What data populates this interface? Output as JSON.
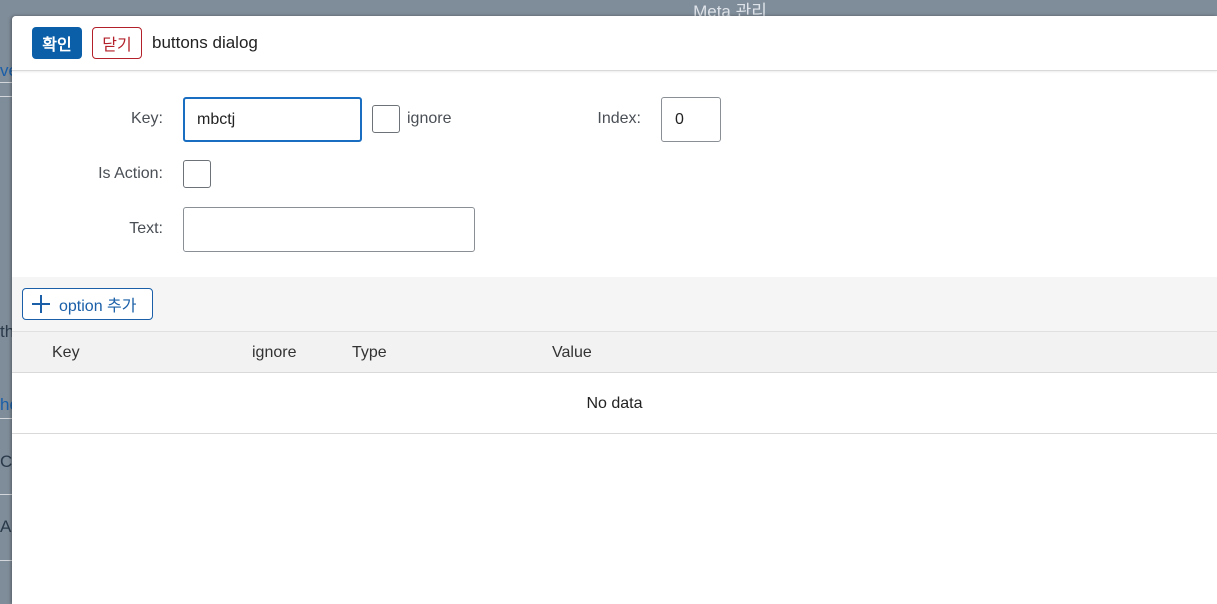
{
  "background": {
    "title": "Meta 관리",
    "left_fragments": [
      "ve",
      "th",
      "he",
      "Co",
      "Ad"
    ]
  },
  "dialog": {
    "confirm_label": "확인",
    "close_label": "닫기",
    "title": "buttons dialog"
  },
  "form": {
    "key_label": "Key:",
    "key_value": "mbctj",
    "ignore_label": "ignore",
    "index_label": "Index:",
    "index_value": "0",
    "is_action_label": "Is Action:",
    "text_label": "Text:",
    "text_value": ""
  },
  "toolbar": {
    "add_option_label": "option 추가"
  },
  "table": {
    "columns": [
      "Key",
      "ignore",
      "Type",
      "Value"
    ],
    "empty_text": "No data"
  },
  "colors": {
    "accent": "#0a5fa8",
    "danger": "#b3202a",
    "focus_border": "#1a6ec2"
  }
}
